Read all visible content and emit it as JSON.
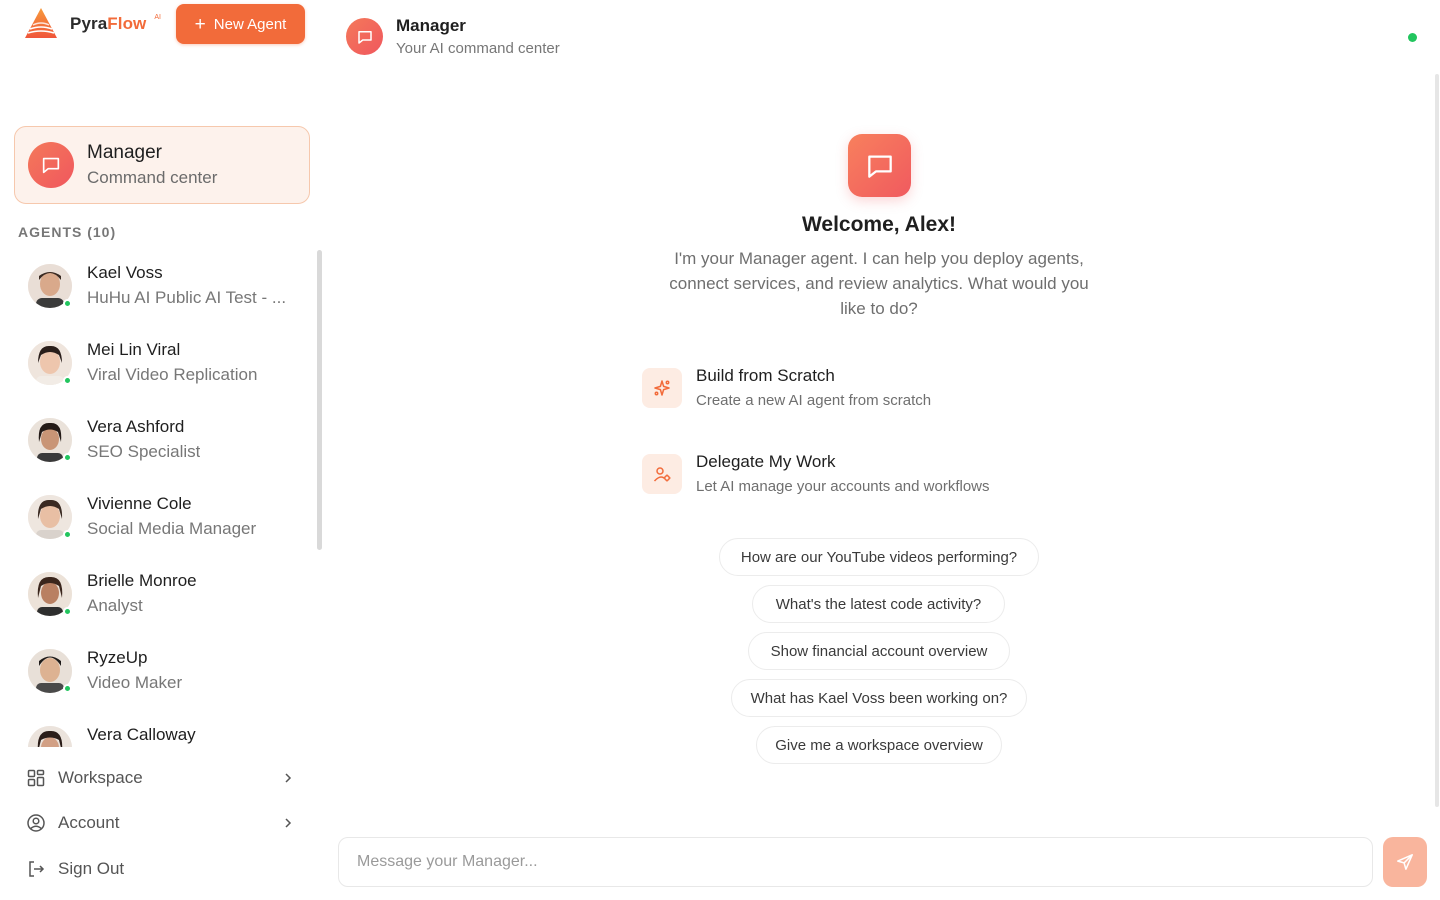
{
  "brand": {
    "name_part1": "Pyra",
    "name_part2": "Flow",
    "badge": "AI"
  },
  "sidebar": {
    "new_agent_label": "New Agent",
    "manager_card": {
      "title": "Manager",
      "subtitle": "Command center"
    },
    "agents_label": "AGENTS (10)",
    "agents": [
      {
        "name": "Kael Voss",
        "role": "HuHu AI Public AI Test - ...",
        "online": true
      },
      {
        "name": "Mei Lin Viral",
        "role": "Viral Video Replication",
        "online": true
      },
      {
        "name": "Vera Ashford",
        "role": "SEO Specialist",
        "online": true
      },
      {
        "name": "Vivienne Cole",
        "role": "Social Media Manager",
        "online": true
      },
      {
        "name": "Brielle Monroe",
        "role": "Analyst",
        "online": true
      },
      {
        "name": "RyzeUp",
        "role": "Video Maker",
        "online": true
      },
      {
        "name": "Vera Calloway",
        "role": "",
        "online": true
      }
    ],
    "menu": {
      "workspace": "Workspace",
      "account": "Account",
      "sign_out": "Sign Out"
    }
  },
  "header": {
    "title": "Manager",
    "subtitle": "Your AI command center"
  },
  "welcome": {
    "title": "Welcome, Alex!",
    "intro": "I'm your Manager agent. I can help you deploy agents, connect services, and review analytics. What would you like to do?"
  },
  "options": [
    {
      "title": "Build from Scratch",
      "subtitle": "Create a new AI agent from scratch"
    },
    {
      "title": "Delegate My Work",
      "subtitle": "Let AI manage your accounts and workflows"
    }
  ],
  "suggestions": [
    "How are our YouTube videos performing?",
    "What's the latest code activity?",
    "Show financial account overview",
    "What has Kael Voss been working on?",
    "Give me a workspace overview"
  ],
  "composer": {
    "placeholder": "Message your Manager..."
  },
  "colors": {
    "accent": "#f26b3a",
    "online": "#22c55e",
    "card_bg": "#fdf2ec"
  }
}
